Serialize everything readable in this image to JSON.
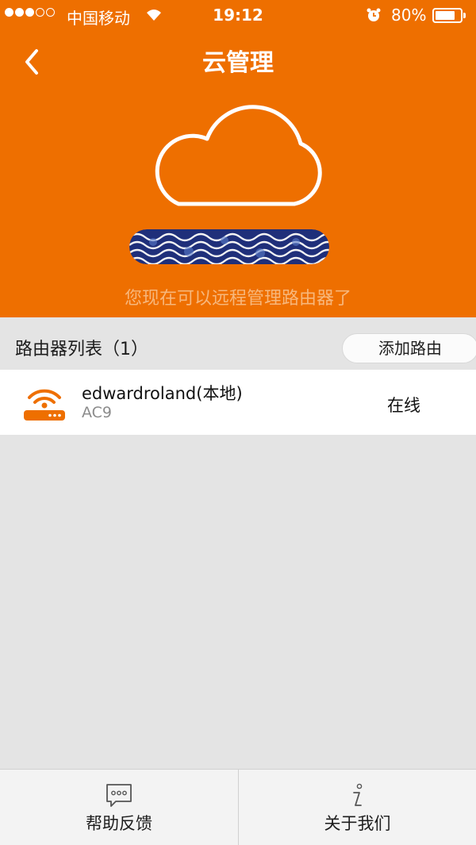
{
  "status_bar": {
    "carrier": "中国移动",
    "time": "19:12",
    "battery": "80%",
    "battery_level": 0.8
  },
  "nav": {
    "title": "云管理",
    "back_icon": "chevron-left-icon"
  },
  "hero": {
    "cloud_icon": "cloud-icon",
    "subtitle": "您现在可以远程管理路由器了"
  },
  "router_list": {
    "title": "路由器列表（1）",
    "add_button": "添加路由",
    "items": [
      {
        "name": "edwardroland(本地)",
        "model": "AC9",
        "status": "在线",
        "icon": "router-icon"
      }
    ]
  },
  "tab_bar": {
    "tabs": [
      {
        "label": "帮助反馈",
        "icon": "chat-bubble-icon"
      },
      {
        "label": "关于我们",
        "icon": "info-icon"
      }
    ]
  },
  "colors": {
    "accent": "#ee6f00",
    "background": "#e4e4e4",
    "subtitle": "#f7b77c"
  }
}
